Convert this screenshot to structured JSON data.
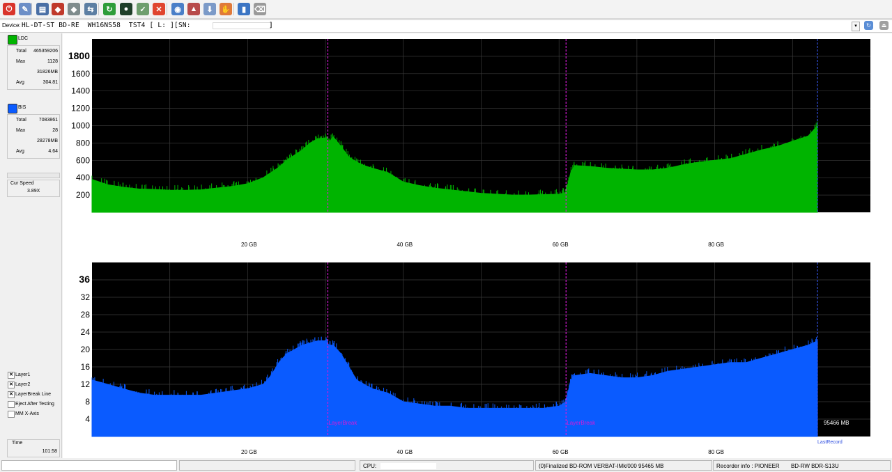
{
  "toolbar": {
    "buttons": [
      {
        "name": "erase-icon",
        "color": "#d9342b",
        "glyph": "⏻"
      },
      {
        "name": "properties-icon",
        "color": "#6d8fc7",
        "glyph": "✎"
      },
      {
        "name": "drive-info-icon",
        "color": "#4a6fa5",
        "glyph": "▤"
      },
      {
        "name": "disc-red-icon",
        "color": "#c0392b",
        "glyph": "◆"
      },
      {
        "name": "disc-gray-icon",
        "color": "#7f8c8d",
        "glyph": "◆"
      },
      {
        "name": "copy-disc-icon",
        "color": "#5d7fa3",
        "glyph": "⇆"
      },
      {
        "name": "refresh-icon",
        "color": "#2e9d3a",
        "glyph": "↻"
      },
      {
        "name": "disc-scan-icon",
        "color": "#1f3f2a",
        "glyph": "●"
      },
      {
        "name": "verify-icon",
        "color": "#6e9e6e",
        "glyph": "✓"
      },
      {
        "name": "stop-icon",
        "color": "#e0452f",
        "glyph": "✕"
      },
      {
        "name": "blue-disc-icon",
        "color": "#4a7fc8",
        "glyph": "◉"
      },
      {
        "name": "burn-icon",
        "color": "#b84b4b",
        "glyph": "▲"
      },
      {
        "name": "save-icon",
        "color": "#7b9ac8",
        "glyph": "⬇"
      },
      {
        "name": "hand-icon",
        "color": "#e07a3a",
        "glyph": "✋"
      },
      {
        "name": "chart-icon",
        "color": "#3b75c4",
        "glyph": "▮"
      },
      {
        "name": "eraser-icon",
        "color": "#9a9a9a",
        "glyph": "⌫"
      }
    ]
  },
  "device": {
    "label": "Device:",
    "value": "HL-DT-ST BD-RE  WH16NS58  TST4 [ L: ][SN:",
    "close_bracket": "]"
  },
  "ldc": {
    "legend": "LDC",
    "color": "#00b400",
    "total_label": "Total",
    "total": "465359206",
    "max_label": "Max",
    "max": "1128",
    "max_pos": "31826MB",
    "avg_label": "Avg",
    "avg": "304.81"
  },
  "bis": {
    "legend": "BIS",
    "color": "#0a5bff",
    "total_label": "Total",
    "total": "7083861",
    "max_label": "Max",
    "max": "28",
    "max_pos": "28278MB",
    "avg_label": "Avg",
    "avg": "4.64"
  },
  "speed": {
    "label": "Cur Speed",
    "value": "3.89X"
  },
  "options": [
    {
      "label": "Layer1",
      "checked": true
    },
    {
      "label": "Layer2",
      "checked": true
    },
    {
      "label": "LayerBreak Line",
      "checked": true
    },
    {
      "label": "Eject After Testing",
      "checked": false
    },
    {
      "label": "MM X-Axis",
      "checked": false
    }
  ],
  "time": {
    "label": "Time",
    "value": "101:58"
  },
  "statusbar": {
    "cpu_label": "CPU:",
    "disc_info": "(0)Finalized  BD-ROM  VERBAT-IMk/000  95465 MB",
    "recorder_label": "Recorder info : PIONEER",
    "recorder_model": "BD-RW  BDR-S13U"
  },
  "chart_data": [
    {
      "type": "area",
      "series": [
        {
          "name": "LDC",
          "color": "#00b400"
        }
      ],
      "x_unit": "GB",
      "xlim": [
        0,
        100
      ],
      "ylim": [
        0,
        2000
      ],
      "yticks": [
        200,
        400,
        600,
        800,
        1000,
        1200,
        1400,
        1600,
        1800
      ],
      "ytick_labels": [
        "200",
        "400",
        "600",
        "800",
        "1000",
        "1200",
        "1400",
        "1600",
        "1800"
      ],
      "xticks": [
        20,
        40,
        60,
        80
      ],
      "xtick_labels": [
        "20 GB",
        "40 GB",
        "60 GB",
        "80 GB"
      ],
      "layerbreaks": [
        30.3,
        60.9
      ],
      "last_record": 93.2,
      "x": [
        0,
        2,
        4,
        6,
        8,
        10,
        12,
        14,
        16,
        18,
        20,
        22,
        24,
        25,
        26,
        27,
        28,
        29,
        30,
        30.3,
        31,
        32,
        33,
        34,
        35,
        36,
        38,
        40,
        42,
        44,
        46,
        48,
        50,
        52,
        54,
        56,
        58,
        60,
        60.9,
        61.5,
        62,
        64,
        66,
        68,
        70,
        72,
        74,
        76,
        78,
        80,
        82,
        84,
        86,
        88,
        90,
        92,
        93.2
      ],
      "y": [
        380,
        320,
        290,
        270,
        265,
        255,
        255,
        260,
        280,
        300,
        330,
        400,
        520,
        600,
        660,
        720,
        800,
        850,
        860,
        800,
        870,
        760,
        640,
        580,
        540,
        510,
        460,
        350,
        310,
        280,
        260,
        240,
        220,
        210,
        200,
        200,
        205,
        210,
        230,
        460,
        540,
        530,
        510,
        500,
        490,
        490,
        510,
        550,
        580,
        600,
        620,
        670,
        720,
        760,
        820,
        880,
        1000
      ]
    },
    {
      "type": "area",
      "series": [
        {
          "name": "BIS",
          "color": "#0a5bff"
        }
      ],
      "x_unit": "GB",
      "xlim": [
        0,
        100
      ],
      "ylim": [
        0,
        40
      ],
      "yticks": [
        4,
        8,
        12,
        16,
        20,
        24,
        28,
        32,
        36
      ],
      "ytick_labels": [
        "4",
        "8",
        "12",
        "16",
        "20",
        "24",
        "28",
        "32",
        "36"
      ],
      "xticks": [
        20,
        40,
        60,
        80
      ],
      "xtick_labels": [
        "20 GB",
        "40 GB",
        "60 GB",
        "80 GB"
      ],
      "layerbreaks": [
        30.3,
        60.9
      ],
      "layerbreak_label": "LayerBreak",
      "last_record": 93.2,
      "last_record_label": "LastRecord",
      "end_label": "95466 MB",
      "x": [
        0,
        2,
        4,
        6,
        8,
        10,
        12,
        14,
        16,
        18,
        20,
        22,
        23,
        24,
        25,
        26,
        27,
        28,
        29,
        30,
        30.3,
        31,
        32,
        33,
        34,
        35,
        36,
        38,
        40,
        42,
        44,
        46,
        48,
        50,
        52,
        54,
        56,
        58,
        60,
        60.9,
        61.5,
        62,
        64,
        66,
        68,
        70,
        72,
        74,
        76,
        78,
        80,
        82,
        84,
        86,
        88,
        90,
        92,
        93.2
      ],
      "y": [
        13,
        12,
        11,
        10,
        9.5,
        9.5,
        9.5,
        9.5,
        10,
        10.5,
        11,
        12,
        14,
        17,
        19,
        20,
        21,
        21.5,
        22,
        22,
        21,
        21,
        19,
        16,
        13,
        12,
        11,
        10,
        8,
        7.5,
        7,
        7,
        6.5,
        6.5,
        6.5,
        6.5,
        6.5,
        6.5,
        7,
        8,
        13,
        14,
        14.5,
        14,
        13.5,
        13.5,
        14,
        15,
        15.5,
        16,
        16.5,
        17,
        17,
        18,
        19,
        20,
        21,
        22
      ]
    }
  ]
}
